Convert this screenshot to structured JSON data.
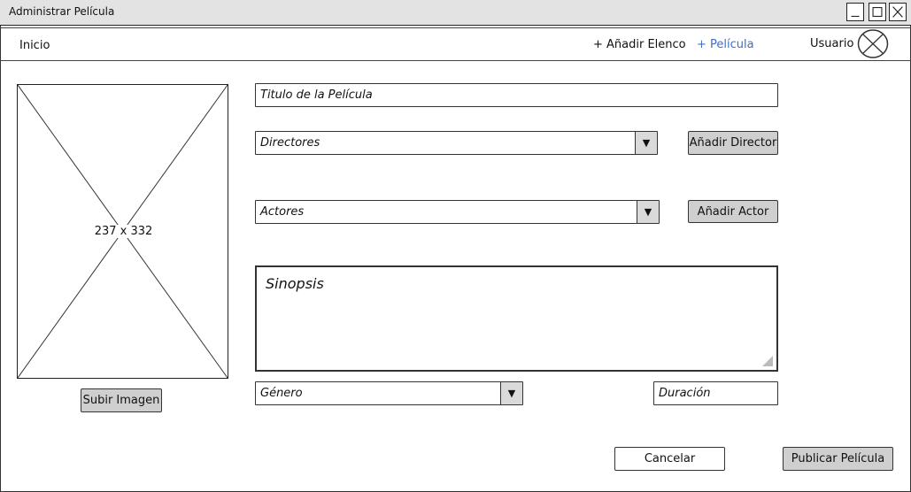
{
  "window": {
    "title": "Administrar Película"
  },
  "menubar": {
    "home_label": "Inicio",
    "add_cast_label": "+ Añadir Elenco",
    "add_film_label": "+ Película",
    "user_label": "Usuario",
    "active_color": "#3b6fd1"
  },
  "image_panel": {
    "size_label": "237 x 332",
    "upload_label": "Subir Imagen"
  },
  "form": {
    "title_placeholder": "Titulo de la Película",
    "directors_placeholder": "Directores",
    "add_director_label": "Añadir Director",
    "actors_placeholder": "Actores",
    "add_actor_label": "Añadir Actor",
    "synopsis_placeholder": "Sinopsis",
    "genre_placeholder": "Género",
    "duration_placeholder": "Duración"
  },
  "actions": {
    "cancel_label": "Cancelar",
    "publish_label": "Publicar Película"
  },
  "icons": {
    "dropdown": "chevron-down-icon",
    "avatar": "avatar-placeholder-icon",
    "minimize": "minimize-icon",
    "maximize": "maximize-icon",
    "close": "close-icon"
  }
}
